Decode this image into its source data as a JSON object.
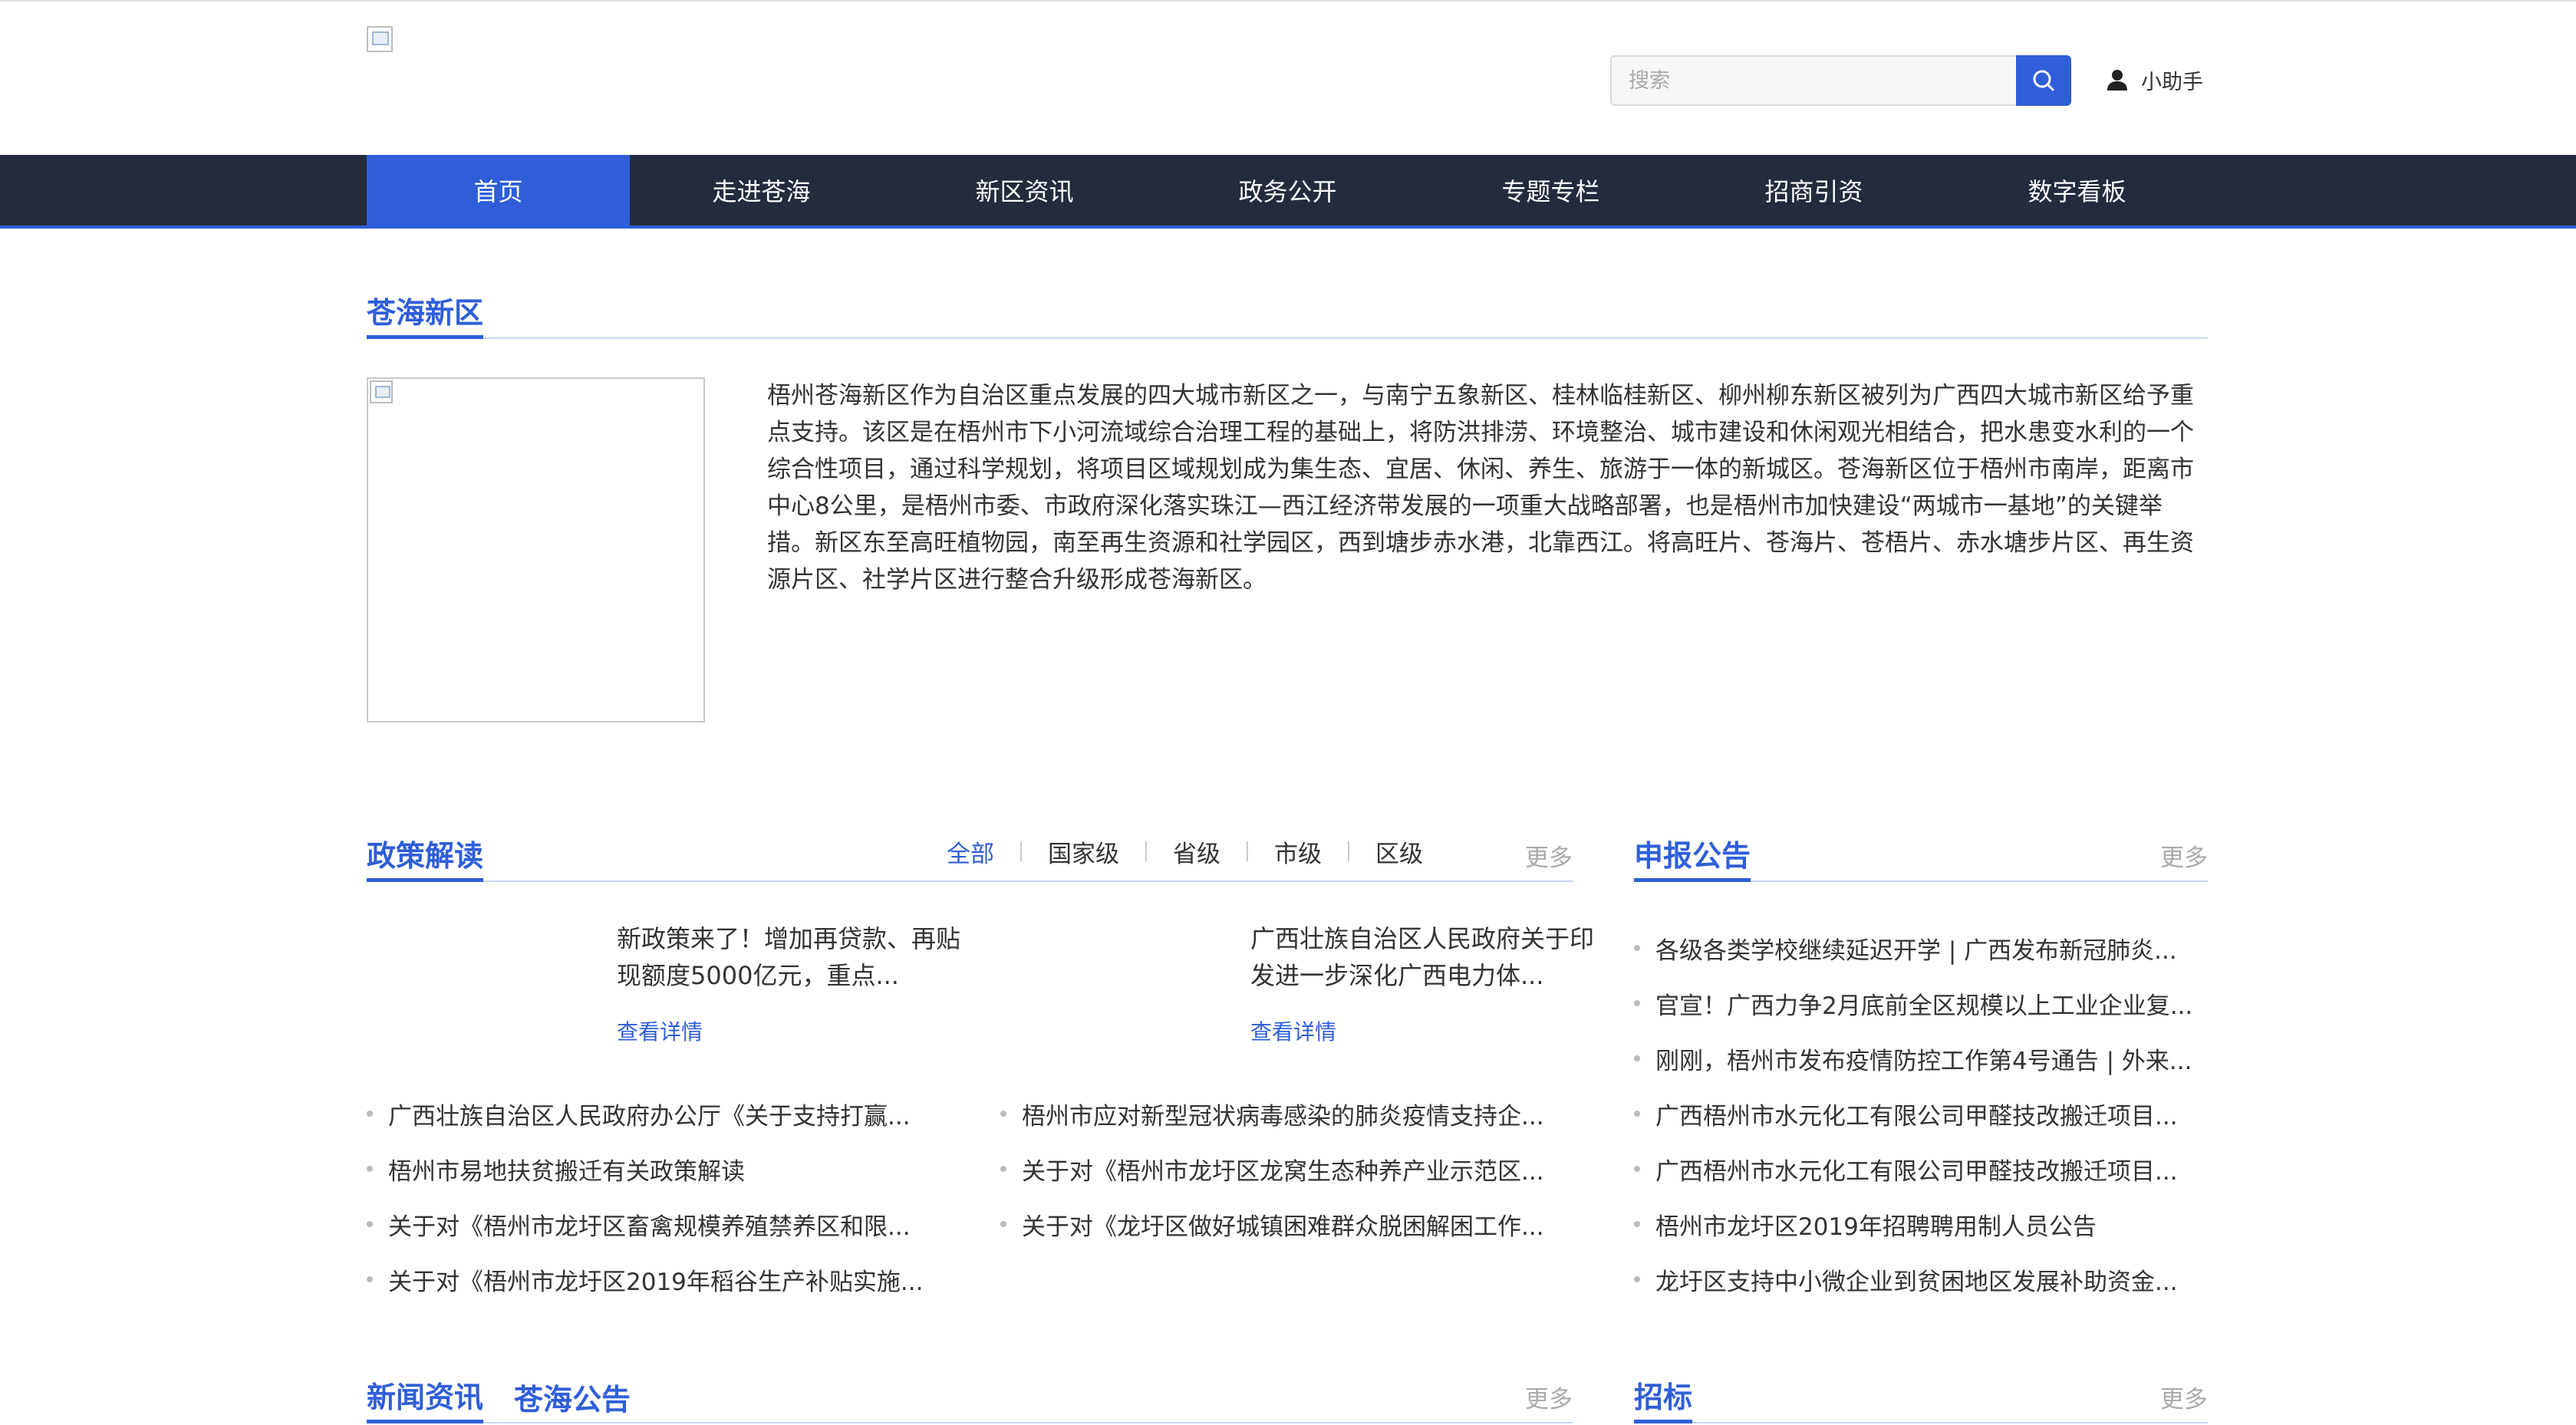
{
  "header": {
    "search_placeholder": "搜索",
    "user_label": "小助手"
  },
  "nav": {
    "items": [
      {
        "label": "首页",
        "active": true
      },
      {
        "label": "走进苍海"
      },
      {
        "label": "新区资讯"
      },
      {
        "label": "政务公开"
      },
      {
        "label": "专题专栏"
      },
      {
        "label": "招商引资"
      },
      {
        "label": "数字看板"
      }
    ]
  },
  "intro": {
    "title": "苍海新区",
    "text": "梧州苍海新区作为自治区重点发展的四大城市新区之一，与南宁五象新区、桂林临桂新区、柳州柳东新区被列为广西四大城市新区给予重点支持。该区是在梧州市下小河流域综合治理工程的基础上，将防洪排涝、环境整治、城市建设和休闲观光相结合，把水患变水利的一个综合性项目，通过科学规划，将项目区域规划成为集生态、宜居、休闲、养生、旅游于一体的新城区。苍海新区位于梧州市南岸，距离市中心8公里，是梧州市委、市政府深化落实珠江—西江经济带发展的一项重大战略部署，也是梧州市加快建设“两城市一基地”的关键举措。新区东至高旺植物园，南至再生资源和社学园区，西到塘步赤水港，北靠西江。将高旺片、苍海片、苍梧片、赤水塘步片区、再生资源片区、社学片区进行整合升级形成苍海新区。"
  },
  "policy": {
    "title": "政策解读",
    "more": "更多",
    "tabs": [
      "全部",
      "国家级",
      "省级",
      "市级",
      "区级"
    ],
    "featured": [
      {
        "title": "新政策来了！增加再贷款、再贴现额度5000亿元，重点...",
        "link": "查看详情"
      },
      {
        "title": "广西壮族自治区人民政府关于印发进一步深化广西电力体...",
        "link": "查看详情"
      }
    ],
    "list_left": [
      "广西壮族自治区人民政府办公厅《关于支持打赢...",
      "梧州市易地扶贫搬迁有关政策解读",
      "关于对《梧州市龙圩区畜禽规模养殖禁养区和限...",
      "关于对《梧州市龙圩区2019年稻谷生产补贴实施..."
    ],
    "list_right": [
      "梧州市应对新型冠状病毒感染的肺炎疫情支持企...",
      "关于对《梧州市龙圩区龙窝生态种养产业示范区...",
      "关于对《龙圩区做好城镇困难群众脱困解困工作..."
    ]
  },
  "notice": {
    "title": "申报公告",
    "more": "更多",
    "items": [
      "各级各类学校继续延迟开学 | 广西发布新冠肺炎...",
      "官宣！广西力争2月底前全区规模以上工业企业复...",
      "刚刚，梧州市发布疫情防控工作第4号通告 | 外来...",
      "广西梧州市水元化工有限公司甲醛技改搬迁项目...",
      "广西梧州市水元化工有限公司甲醛技改搬迁项目...",
      "梧州市龙圩区2019年招聘聘用制人员公告",
      "龙圩区支持中小微企业到贫困地区发展补助资金..."
    ]
  },
  "news": {
    "title": "新闻资讯",
    "title2": "苍海公告",
    "more": "更多"
  },
  "bidding": {
    "title": "招标",
    "more": "更多"
  }
}
